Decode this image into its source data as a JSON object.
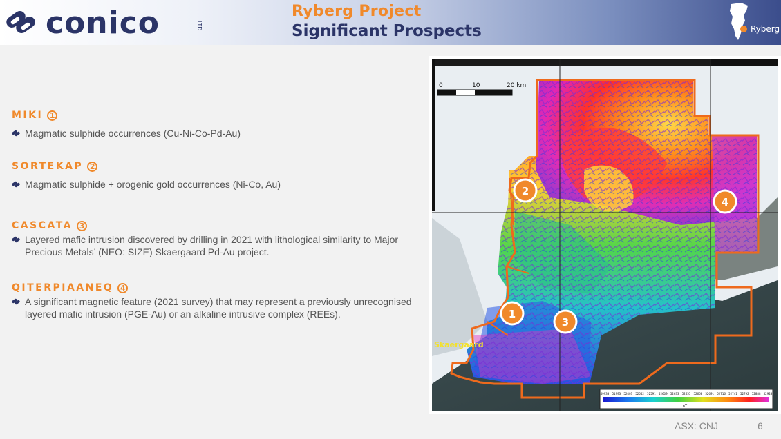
{
  "header": {
    "company_logo_text": "conico",
    "logo_suffix": "LTD",
    "title_line1": "Ryberg Project",
    "title_line2": "Significant Prospects",
    "location_label": "Ryberg"
  },
  "prospects": [
    {
      "name": "MIKI",
      "number": "1",
      "description": "Magmatic sulphide occurrences (Cu-Ni-Co-Pd-Au)"
    },
    {
      "name": "SORTEKAP",
      "number": "2",
      "description": "Magmatic sulphide + orogenic gold occurrences (Ni-Co, Au)"
    },
    {
      "name": "CASCATA",
      "number": "3",
      "description": "Layered mafic intrusion discovered by drilling in 2021 with lithological similarity to Major Precious Metals’ (NEO: SIZE) Skaergaard Pd-Au project."
    },
    {
      "name": "QITERPIAANEQ",
      "number": "4",
      "description": " A significant magnetic feature (2021 survey) that may represent a previously unrecognised layered mafic intrusion (PGE-Au) or an alkaline intrusive complex (REEs)."
    }
  ],
  "map": {
    "scale_labels": [
      "0",
      "10",
      "20 km"
    ],
    "place_label": "Skaergaard",
    "markers": [
      "1",
      "2",
      "3",
      "4"
    ],
    "legend_values": [
      "49933",
      "51993",
      "52403",
      "52542",
      "52591",
      "52609",
      "52633",
      "52655",
      "52668",
      "52691",
      "52716",
      "52741",
      "52792",
      "52888",
      "52923"
    ],
    "legend_unit": "nT",
    "colors": {
      "outline": "#ee6a1d",
      "marker": "#f0892b"
    }
  },
  "footer": {
    "ticker": "ASX: CNJ",
    "page_number": "6"
  }
}
